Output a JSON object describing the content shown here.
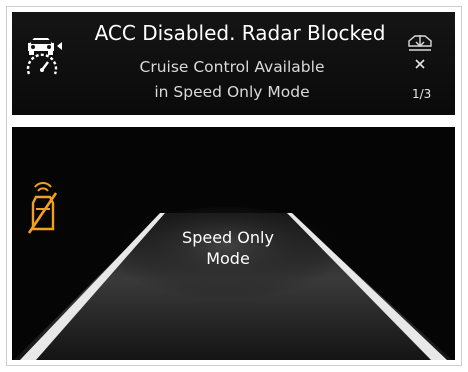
{
  "notification": {
    "title": "ACC Disabled. Radar Blocked",
    "line1": "Cruise Control Available",
    "line2": "in Speed Only Mode",
    "page_indicator": "1/3",
    "icons": {
      "left": "acc-car-gauge-icon",
      "right": "cruise-nav-icon",
      "close": "close-icon"
    }
  },
  "display": {
    "mode_label": "Speed Only Mode",
    "icons": {
      "warning": "radar-blocked-icon"
    },
    "colors": {
      "warning": "#f0a020",
      "background": "#050505",
      "lane_line": "#e8e8e8"
    }
  }
}
